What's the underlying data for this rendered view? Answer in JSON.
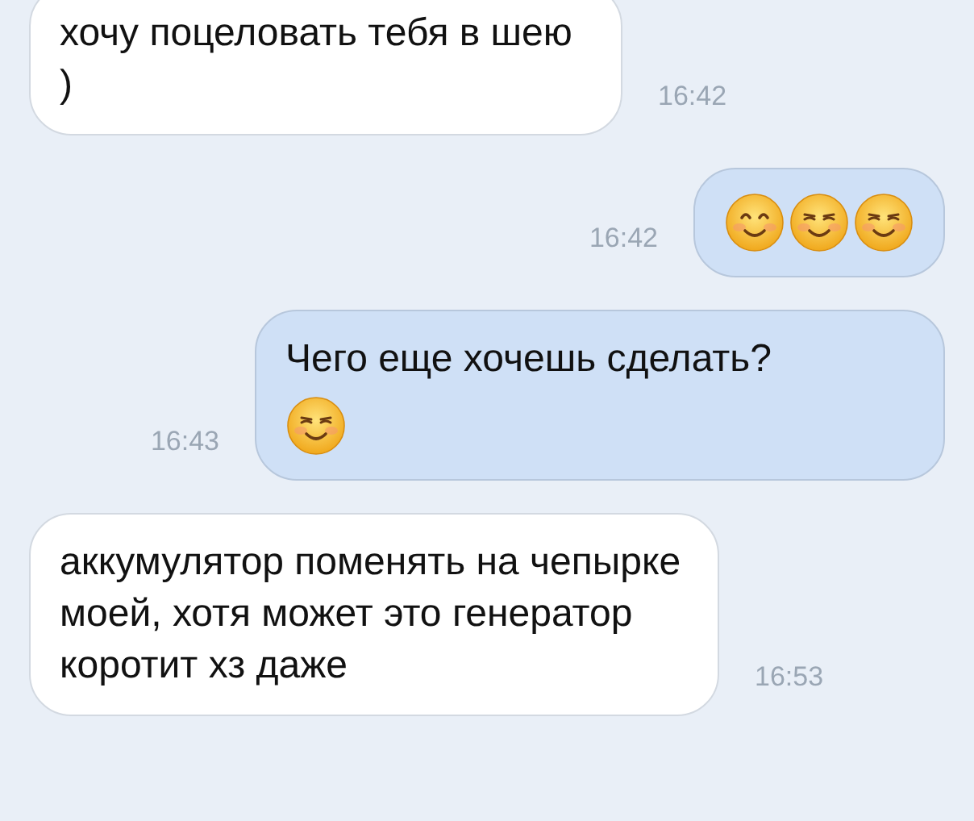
{
  "messages": [
    {
      "kind": "incoming",
      "text": "хочу поцеловать тебя в шею )",
      "time": "16:42"
    },
    {
      "kind": "outgoing",
      "emojis": [
        {
          "kind": "smiling"
        },
        {
          "kind": "blushing"
        },
        {
          "kind": "blushing"
        }
      ],
      "time": "16:42"
    },
    {
      "kind": "outgoing",
      "text": "Чего еще хочешь сделать?",
      "emojis": [
        {
          "kind": "blushing"
        }
      ],
      "time": "16:43"
    },
    {
      "kind": "incoming",
      "text": "аккумулятор поменять на чепырке моей, хотя может это генератор коротит хз даже",
      "time": "16:53"
    }
  ]
}
